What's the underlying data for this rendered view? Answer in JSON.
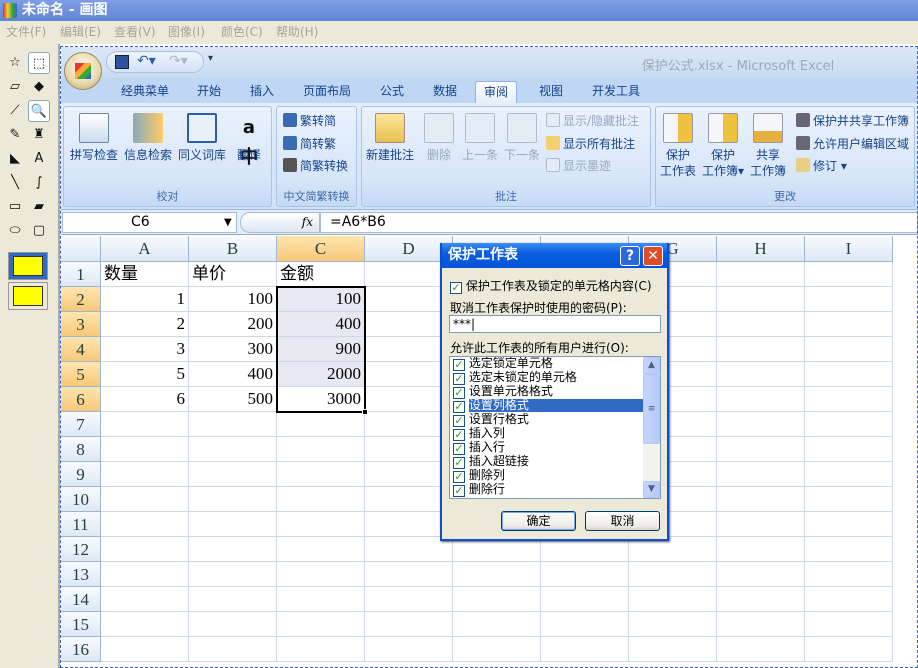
{
  "paint": {
    "title": "未命名 - 画图",
    "menu": [
      "文件(F)",
      "编辑(E)",
      "查看(V)",
      "图像(I)",
      "颜色(C)",
      "帮助(H)"
    ],
    "tools": [
      "free-select",
      "rect-select",
      "eraser",
      "fill",
      "color-picker",
      "magnifier",
      "pencil",
      "brush",
      "airbrush",
      "text",
      "line",
      "curve",
      "rectangle",
      "polygon",
      "ellipse",
      "rounded-rect"
    ]
  },
  "excel": {
    "title": "保护公式.xlsx - Microsoft Excel",
    "tabs": [
      "经典菜单",
      "开始",
      "插入",
      "页面布局",
      "公式",
      "数据",
      "审阅",
      "视图",
      "开发工具"
    ],
    "active_tab": "审阅",
    "groups": {
      "proof": {
        "label": "校对",
        "buttons": [
          "拼写检查",
          "信息检索",
          "同义词库",
          "翻译"
        ]
      },
      "chinese": {
        "label": "中文简繁转换",
        "buttons": [
          "繁转简",
          "简转繁",
          "简繁转换"
        ]
      },
      "comments": {
        "label": "批注",
        "buttons": [
          "新建批注",
          "删除",
          "上一条",
          "下一条"
        ],
        "small": [
          "显示/隐藏批注",
          "显示所有批注",
          "显示墨迹"
        ]
      },
      "changes": {
        "label": "更改",
        "buttons": [
          "保护",
          "工作表",
          "保护",
          "工作簿",
          "共享",
          "工作簿"
        ],
        "small": [
          "保护并共享工作簿",
          "允许用户编辑区域",
          "修订"
        ]
      }
    },
    "namebox": "C6",
    "fx": "fx",
    "formula": "=A6*B6",
    "columns": [
      "A",
      "B",
      "C",
      "D",
      "E",
      "F",
      "G",
      "H",
      "I"
    ],
    "rows": [
      [
        "数量",
        "单价",
        "金额"
      ],
      [
        "1",
        "100",
        "100"
      ],
      [
        "2",
        "200",
        "400"
      ],
      [
        "3",
        "300",
        "900"
      ],
      [
        "5",
        "400",
        "2000"
      ],
      [
        "6",
        "500",
        "3000"
      ]
    ],
    "row_count": 16,
    "selection": "C2:C6",
    "active_cell": "C6"
  },
  "dialog": {
    "title": "保护工作表",
    "help": "?",
    "close": "✕",
    "protect_label": "保护工作表及锁定的单元格内容(C)",
    "password_label": "取消工作表保护时使用的密码(P):",
    "password_value": "***",
    "allow_label": "允许此工作表的所有用户进行(O):",
    "permissions": [
      "选定锁定单元格",
      "选定未锁定的单元格",
      "设置单元格格式",
      "设置列格式",
      "设置行格式",
      "插入列",
      "插入行",
      "插入超链接",
      "删除列",
      "删除行"
    ],
    "selected_permission": 3,
    "ok": "确定",
    "cancel": "取消"
  },
  "colors": {
    "accent": "#316ac5",
    "header_highlight": "#f8c878",
    "selection_fill": "#e8e8f4"
  }
}
